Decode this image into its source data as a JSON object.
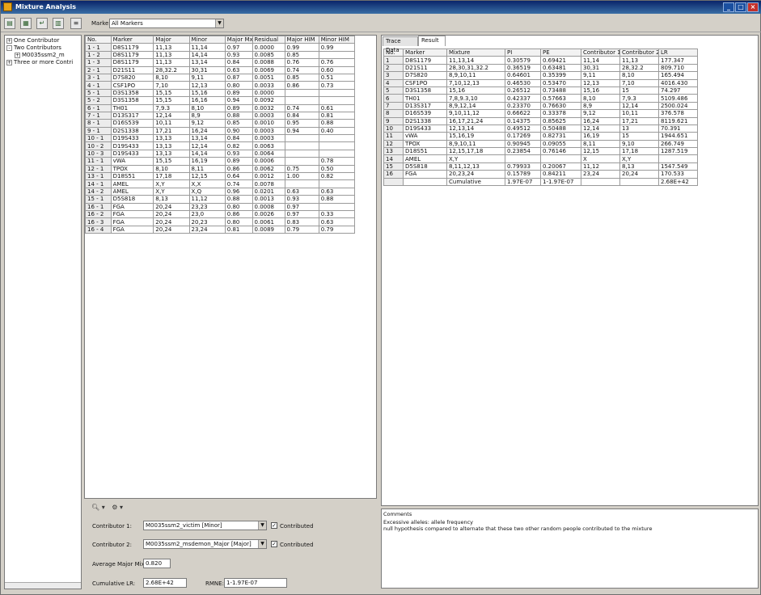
{
  "window": {
    "title": "Mixture Analysis"
  },
  "toolbar": {
    "marker_label": "Marker",
    "marker_value": "All Markers"
  },
  "tree": {
    "items": [
      {
        "label": "One Contributor",
        "expander": "+"
      },
      {
        "label": "Two Contributors",
        "expander": "-"
      },
      {
        "label": "M0035ssm2_m",
        "expander": "+"
      },
      {
        "label": "Three or more Contri",
        "expander": "+"
      }
    ]
  },
  "mixture_table": {
    "columns": [
      "No.",
      "Marker",
      "Major",
      "Minor",
      "Major Mx",
      "Residual",
      "Major HIM",
      "Minor HIM"
    ],
    "rows": [
      [
        "1 - 1",
        "D8S1179",
        "11,13",
        "11,14",
        "0.97",
        "0.0000",
        "0.99",
        "0.99"
      ],
      [
        "1 - 2",
        "D8S1179",
        "11,13",
        "14,14",
        "0.93",
        "0.0085",
        "0.85",
        ""
      ],
      [
        "1 - 3",
        "D8S1179",
        "11,13",
        "13,14",
        "0.84",
        "0.0088",
        "0.76",
        "0.76"
      ],
      [
        "2 - 1",
        "D21S11",
        "28,32.2",
        "30,31",
        "0.63",
        "0.0069",
        "0.74",
        "0.60"
      ],
      [
        "3 - 1",
        "D7S820",
        "8,10",
        "9,11",
        "0.87",
        "0.0051",
        "0.85",
        "0.51"
      ],
      [
        "4 - 1",
        "CSF1PO",
        "7,10",
        "12,13",
        "0.80",
        "0.0033",
        "0.86",
        "0.73"
      ],
      [
        "5 - 1",
        "D3S1358",
        "15,15",
        "15,16",
        "0.89",
        "0.0000",
        "",
        ""
      ],
      [
        "5 - 2",
        "D3S1358",
        "15,15",
        "16,16",
        "0.94",
        "0.0092",
        "",
        ""
      ],
      [
        "6 - 1",
        "TH01",
        "7,9.3",
        "8,10",
        "0.89",
        "0.0032",
        "0.74",
        "0.61"
      ],
      [
        "7 - 1",
        "D13S317",
        "12,14",
        "8,9",
        "0.88",
        "0.0003",
        "0.84",
        "0.81"
      ],
      [
        "8 - 1",
        "D16S539",
        "10,11",
        "9,12",
        "0.85",
        "0.0010",
        "0.95",
        "0.88"
      ],
      [
        "9 - 1",
        "D2S1338",
        "17,21",
        "16,24",
        "0.90",
        "0.0003",
        "0.94",
        "0.40"
      ],
      [
        "10 - 1",
        "D19S433",
        "13,13",
        "13,14",
        "0.84",
        "0.0003",
        "",
        ""
      ],
      [
        "10 - 2",
        "D19S433",
        "13,13",
        "12,14",
        "0.82",
        "0.0063",
        "",
        ""
      ],
      [
        "10 - 3",
        "D19S433",
        "13,13",
        "14,14",
        "0.93",
        "0.0064",
        "",
        ""
      ],
      [
        "11 - 1",
        "vWA",
        "15,15",
        "16,19",
        "0.89",
        "0.0006",
        "",
        "0.78"
      ],
      [
        "12 - 1",
        "TPOX",
        "8,10",
        "8,11",
        "0.86",
        "0.0062",
        "0.75",
        "0.50"
      ],
      [
        "13 - 1",
        "D18S51",
        "17,18",
        "12,15",
        "0.64",
        "0.0012",
        "1.00",
        "0.82"
      ],
      [
        "14 - 1",
        "AMEL",
        "X,Y",
        "X,X",
        "0.74",
        "0.0078",
        "",
        ""
      ],
      [
        "14 - 2",
        "AMEL",
        "X,Y",
        "X,Q",
        "0.96",
        "0.0201",
        "0.63",
        "0.63"
      ],
      [
        "15 - 1",
        "D5S818",
        "8,13",
        "11,12",
        "0.88",
        "0.0013",
        "0.93",
        "0.88"
      ],
      [
        "16 - 1",
        "FGA",
        "20,24",
        "23,23",
        "0.80",
        "0.0008",
        "0.97",
        ""
      ],
      [
        "16 - 2",
        "FGA",
        "20,24",
        "23,0",
        "0.86",
        "0.0026",
        "0.97",
        "0.33"
      ],
      [
        "16 - 3",
        "FGA",
        "20,24",
        "20,23",
        "0.80",
        "0.0061",
        "0.83",
        "0.63"
      ],
      [
        "16 - 4",
        "FGA",
        "20,24",
        "23,24",
        "0.81",
        "0.0089",
        "0.79",
        "0.79"
      ]
    ]
  },
  "tabs": [
    "Trace Data",
    "Result"
  ],
  "result_table": {
    "columns": [
      "No.",
      "Marker",
      "Mixture",
      "PI",
      "PE",
      "Contributor 1",
      "Contributor 2",
      "LR"
    ],
    "rows": [
      [
        "1",
        "D8S1179",
        "11,13,14",
        "0.30579",
        "0.69421",
        "11,14",
        "11,13",
        "177.347"
      ],
      [
        "2",
        "D21S11",
        "28,30,31,32.2",
        "0.36519",
        "0.63481",
        "30,31",
        "28,32.2",
        "809.710"
      ],
      [
        "3",
        "D7S820",
        "8,9,10,11",
        "0.64601",
        "0.35399",
        "9,11",
        "8,10",
        "165.494"
      ],
      [
        "4",
        "CSF1PO",
        "7,10,12,13",
        "0.46530",
        "0.53470",
        "12,13",
        "7,10",
        "4016.430"
      ],
      [
        "5",
        "D3S1358",
        "15,16",
        "0.26512",
        "0.73488",
        "15,16",
        "15",
        "74.297"
      ],
      [
        "6",
        "TH01",
        "7,8,9.3,10",
        "0.42337",
        "0.57663",
        "8,10",
        "7,9.3",
        "5109.486"
      ],
      [
        "7",
        "D13S317",
        "8,9,12,14",
        "0.23370",
        "0.76630",
        "8,9",
        "12,14",
        "2500.024"
      ],
      [
        "8",
        "D16S539",
        "9,10,11,12",
        "0.66622",
        "0.33378",
        "9,12",
        "10,11",
        "376.578"
      ],
      [
        "9",
        "D2S1338",
        "16,17,21,24",
        "0.14375",
        "0.85625",
        "16,24",
        "17,21",
        "8119.621"
      ],
      [
        "10",
        "D19S433",
        "12,13,14",
        "0.49512",
        "0.50488",
        "12,14",
        "13",
        "70.391"
      ],
      [
        "11",
        "vWA",
        "15,16,19",
        "0.17269",
        "0.82731",
        "16,19",
        "15",
        "1944.651"
      ],
      [
        "12",
        "TPOX",
        "8,9,10,11",
        "0.90945",
        "0.09055",
        "8,11",
        "9,10",
        "266.749"
      ],
      [
        "13",
        "D18S51",
        "12,15,17,18",
        "0.23854",
        "0.76146",
        "12,15",
        "17,18",
        "1287.519"
      ],
      [
        "14",
        "AMEL",
        "X,Y",
        "",
        "",
        "X",
        "X,Y",
        ""
      ],
      [
        "15",
        "D5S818",
        "8,11,12,13",
        "0.79933",
        "0.20067",
        "11,12",
        "8,13",
        "1547.549"
      ],
      [
        "16",
        "FGA",
        "20,23,24",
        "0.15789",
        "0.84211",
        "23,24",
        "20,24",
        "170.533"
      ],
      [
        "",
        "",
        "Cumulative",
        "1.97E-07",
        "1-1.97E-07",
        "",
        "",
        "2.68E+42"
      ]
    ]
  },
  "comments": {
    "title": "Comments",
    "line1": "Excessive alleles: allele frequency",
    "line2": "null hypothesis compared to alternate that these two other random people contributed to the mixture"
  },
  "contributors": {
    "c1_label": "Contributor 1:",
    "c1_value": "M0035ssm2_victim [Minor]",
    "c1_check_label": "Contributed",
    "c2_label": "Contributor 2:",
    "c2_value": "M0035ssm2_msdemon_Major [Major]",
    "c2_check_label": "Contributed",
    "avg_label": "Average Major Mix:",
    "avg_value": "0.820",
    "cum_lr_label": "Cumulative LR:",
    "cum_lr_value": "2.68E+42",
    "rmne_label": "RMNE:",
    "rmne_value": "1-1.97E-07"
  },
  "icons": {
    "zoom": "zoom-icon",
    "settings": "settings-icon"
  }
}
